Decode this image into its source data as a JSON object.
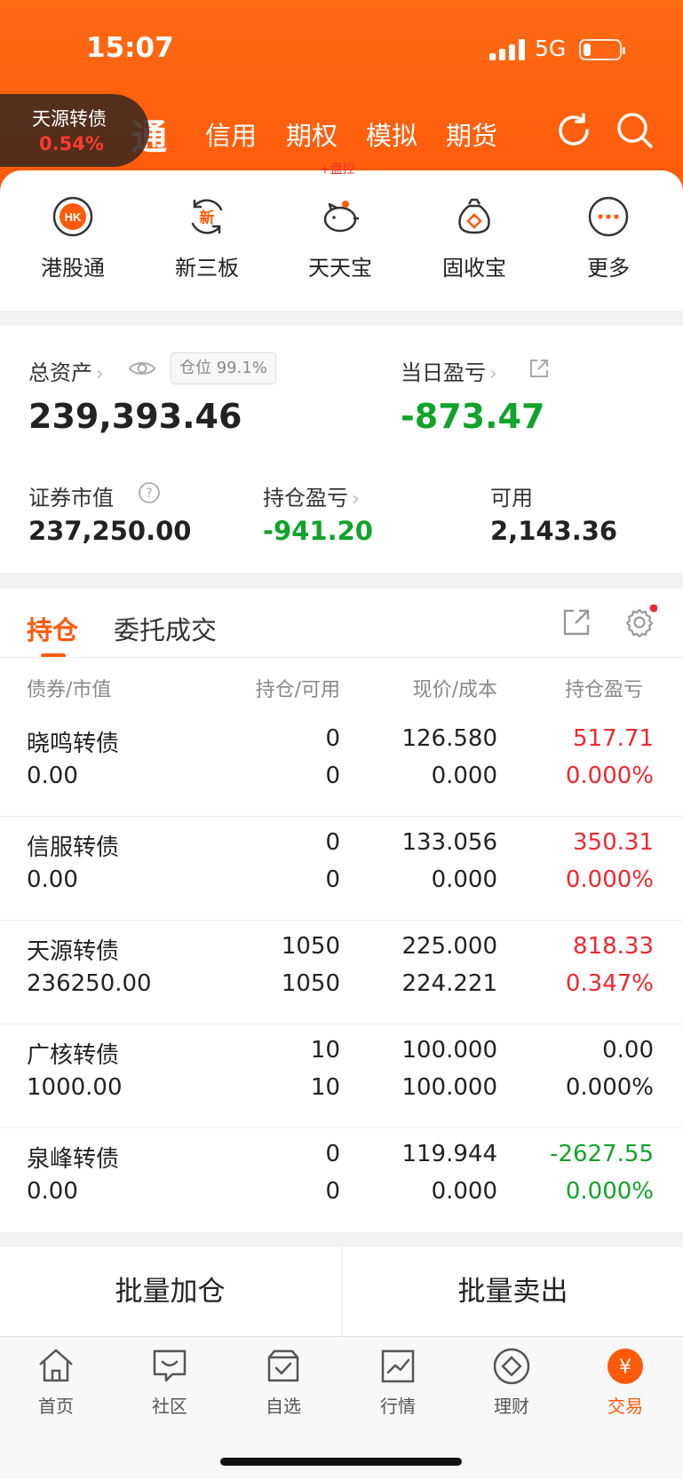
{
  "status": {
    "time": "15:07",
    "network": "5G"
  },
  "top_tabs": [
    "通",
    "信用",
    "期权",
    "模拟",
    "期货"
  ],
  "ticker": {
    "name": "天源转债",
    "change": "0.54%"
  },
  "monitor_tag": "+盘控",
  "quick_actions": [
    {
      "label": "港股通",
      "icon": "hk-icon",
      "icon_text": "HK"
    },
    {
      "label": "新三板",
      "icon": "new-board-icon",
      "icon_text": "新"
    },
    {
      "label": "天天宝",
      "icon": "piggy-bank-icon"
    },
    {
      "label": "固收宝",
      "icon": "money-bag-icon"
    },
    {
      "label": "更多",
      "icon": "more-icon"
    }
  ],
  "assets": {
    "total_label": "总资产",
    "position_ratio": "仓位 99.1%",
    "total_value": "239,393.46",
    "daily_pl_label": "当日盈亏",
    "daily_pl_value": "-873.47",
    "market_value_label": "证券市值",
    "market_value": "237,250.00",
    "holding_pl_label": "持仓盈亏",
    "holding_pl_value": "-941.20",
    "available_label": "可用",
    "available_value": "2,143.36"
  },
  "holdings": {
    "tabs": [
      "持仓",
      "委托成交"
    ],
    "columns": [
      "债券/市值",
      "持仓/可用",
      "现价/成本",
      "持仓盈亏"
    ],
    "rows": [
      {
        "name": "晓鸣转债",
        "value": "0.00",
        "hold": "0",
        "avail": "0",
        "price": "126.580",
        "cost": "0.000",
        "pl": "517.71",
        "pl_pct": "0.000%",
        "tone": "red"
      },
      {
        "name": "信服转债",
        "value": "0.00",
        "hold": "0",
        "avail": "0",
        "price": "133.056",
        "cost": "0.000",
        "pl": "350.31",
        "pl_pct": "0.000%",
        "tone": "red"
      },
      {
        "name": "天源转债",
        "value": "236250.00",
        "hold": "1050",
        "avail": "1050",
        "price": "225.000",
        "cost": "224.221",
        "pl": "818.33",
        "pl_pct": "0.347%",
        "tone": "red"
      },
      {
        "name": "广核转债",
        "value": "1000.00",
        "hold": "10",
        "avail": "10",
        "price": "100.000",
        "cost": "100.000",
        "pl": "0.00",
        "pl_pct": "0.000%",
        "tone": "neutral"
      },
      {
        "name": "泉峰转债",
        "value": "0.00",
        "hold": "0",
        "avail": "0",
        "price": "119.944",
        "cost": "0.000",
        "pl": "-2627.55",
        "pl_pct": "0.000%",
        "tone": "green"
      }
    ]
  },
  "bulk": {
    "add": "批量加仓",
    "sell": "批量卖出"
  },
  "nav": [
    {
      "label": "首页",
      "icon": "home-icon"
    },
    {
      "label": "社区",
      "icon": "community-icon"
    },
    {
      "label": "自选",
      "icon": "watchlist-icon"
    },
    {
      "label": "行情",
      "icon": "market-icon"
    },
    {
      "label": "理财",
      "icon": "wealth-icon"
    },
    {
      "label": "交易",
      "icon": "trade-icon",
      "active": true
    }
  ],
  "colors": {
    "brand": "#ff5a0a",
    "up": "#f0282d",
    "down": "#11a32a"
  }
}
